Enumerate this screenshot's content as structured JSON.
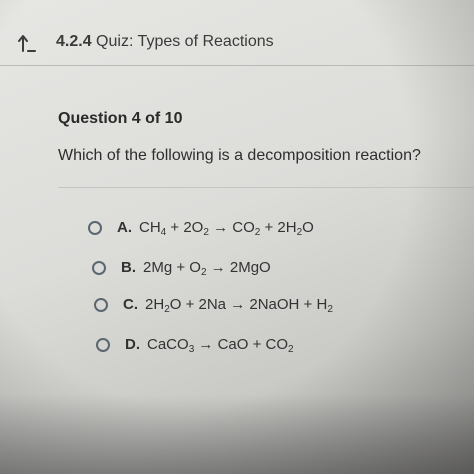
{
  "header": {
    "lesson_number": "4.2.4",
    "lesson_title": "Quiz: Types of Reactions"
  },
  "question": {
    "number_label": "Question 4 of 10",
    "prompt": "Which of the following is a decomposition reaction?"
  },
  "options": [
    {
      "letter": "A.",
      "parts": [
        {
          "t": "CH"
        },
        {
          "s": "4"
        },
        {
          "t": " + 2O"
        },
        {
          "s": "2"
        },
        {
          "t": " → CO"
        },
        {
          "s": "2"
        },
        {
          "t": " + 2H"
        },
        {
          "s": "2"
        },
        {
          "t": "O"
        }
      ]
    },
    {
      "letter": "B.",
      "parts": [
        {
          "t": "2Mg + O"
        },
        {
          "s": "2"
        },
        {
          "t": " → 2MgO"
        }
      ]
    },
    {
      "letter": "C.",
      "parts": [
        {
          "t": "2H"
        },
        {
          "s": "2"
        },
        {
          "t": "O + 2Na → 2NaOH + H"
        },
        {
          "s": "2"
        }
      ]
    },
    {
      "letter": "D.",
      "parts": [
        {
          "t": "CaCO"
        },
        {
          "s": "3"
        },
        {
          "t": " → CaO + CO"
        },
        {
          "s": "2"
        }
      ]
    }
  ]
}
